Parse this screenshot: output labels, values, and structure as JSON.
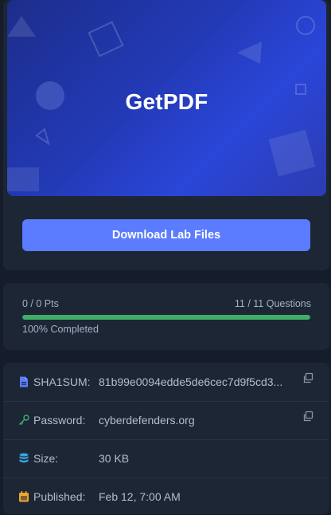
{
  "banner": {
    "title": "GetPDF"
  },
  "actions": {
    "download_label": "Download Lab Files"
  },
  "progress": {
    "points": "0 / 0 Pts",
    "questions": "11 / 11 Questions",
    "completed_label": "100% Completed",
    "fraction": 1.0,
    "bar_color": "#3fae6a"
  },
  "info": {
    "sha1": {
      "label": "SHA1SUM:",
      "value": "81b99e0094edde5de6cec7d9f5cd3...",
      "icon": "file-icon"
    },
    "password": {
      "label": "Password:",
      "value": "cyberdefenders.org",
      "icon": "key-icon"
    },
    "size": {
      "label": "Size:",
      "value": "30 KB",
      "icon": "database-icon"
    },
    "published": {
      "label": "Published:",
      "value": "Feb 12, 7:00 AM",
      "icon": "calendar-icon"
    }
  },
  "colors": {
    "accent": "#5b7cff",
    "background": "#161d2a",
    "card": "#1d2635"
  }
}
